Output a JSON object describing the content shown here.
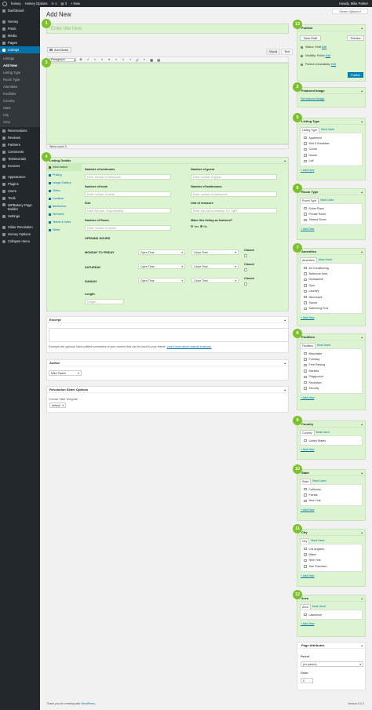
{
  "admin_bar": {
    "site_name": "homey",
    "updates": "1",
    "site_menu": "Homey Options",
    "comments": "3",
    "new_label": "New",
    "howdy": "Howdy, Mike Parker"
  },
  "sidebar": {
    "items_top": [
      "Dashboard",
      "Homey",
      "Posts",
      "Media",
      "Pages"
    ],
    "current": "Listings",
    "submenu": [
      "Listings",
      "Add New",
      "Listing Type",
      "Room Type",
      "Amenities",
      "Facilities",
      "Country",
      "State",
      "City",
      "Area"
    ],
    "items_bottom": [
      "Reservations",
      "Reviews",
      "Partners",
      "Comments",
      "Testimonials",
      "Invoices"
    ],
    "items_bottom2": [
      "Appearance",
      "Plugins",
      "Users",
      "Tools",
      "WPBakery Page Builder",
      "Settings"
    ],
    "items_bottom3": [
      "Slider Revolution",
      "Homey Options",
      "Collapse menu"
    ]
  },
  "screen_options": "Screen Options",
  "page_title": "Add New",
  "title_placeholder": "Enter title here",
  "editor": {
    "add_media": "Add Media",
    "tab_visual": "Visual",
    "tab_text": "Text",
    "format": "Paragraph",
    "word_count": "Word count: 0",
    "toolbar": [
      "B",
      "I",
      "≡",
      "≡",
      "❝",
      "≡",
      "≡",
      "≡",
      "🔗",
      "≡",
      "▦",
      "▤"
    ]
  },
  "badges": [
    "1",
    "2",
    "3",
    "4",
    "5",
    "6",
    "7",
    "8",
    "9",
    "10",
    "11",
    "12",
    "13"
  ],
  "listing_details": {
    "title": "Listing Details",
    "tabs": [
      "Information",
      "Pricing",
      "Image Gallery",
      "Video",
      "Location",
      "Bedrooms",
      "Services",
      "Terms & rules",
      "Slider"
    ],
    "fields": {
      "bedrooms_label": "Number of bedrooms",
      "bedrooms_ph": "Enter number of bedrooms",
      "guest_label": "Number of guest",
      "guest_ph": "Enter number of guest",
      "beds_label": "Number of beds",
      "beds_ph": "Enter number of beds",
      "bathrooms_label": "Number of bathrooms",
      "bathrooms_ph": "Enter number of bathrooms",
      "size_label": "Size",
      "size_ph": "Enter the size. Only numbers",
      "unit_label": "Unit of measure",
      "unit_ph": "Enter the unit of measure. Ex. SqFt",
      "room_label": "Number of Room",
      "room_ph": "Enter number of rooms",
      "featured_label": "Make this listing as featured?",
      "yes": "Yes",
      "no": "No",
      "opening_hours": "OPENING HOURS",
      "days": [
        "MONDAY TO FRIDAY",
        "SATURDAY",
        "SUNDAY"
      ],
      "open_time": "Open Time",
      "close_time": "Close Time",
      "closed": "Closed",
      "length_label": "Length",
      "length_ph": "Length"
    }
  },
  "excerpt": {
    "title": "Excerpt",
    "help": "Excerpts are optional hand-crafted summaries of your content that can be used in your theme.",
    "link": "Learn more about manual excerpts."
  },
  "author": {
    "title": "Author",
    "value": "Mike Parker"
  },
  "revslider": {
    "title": "Revolution Slider Options",
    "label": "Choose Slide Template",
    "value": "default"
  },
  "publish": {
    "title": "Publish",
    "save_draft": "Save Draft",
    "preview": "Preview",
    "status": "Status: Draft",
    "visibility": "Visibility: Public",
    "publish_when": "Publish immediately",
    "edit": "Edit",
    "button": "Publish"
  },
  "featured_image": {
    "title": "Featured Image",
    "link": "Set featured image"
  },
  "tax_common": {
    "most_used": "Most Used",
    "add_new": "+ Add New"
  },
  "taxonomies": [
    {
      "title": "Listing Type",
      "tab": "Listing Type",
      "items": [
        "Apartment",
        "Bed & Breakfast",
        "Condo",
        "House",
        "Loft"
      ]
    },
    {
      "title": "Room Type",
      "tab": "Room Type",
      "items": [
        "Entire Place",
        "Private Room",
        "Shared Room"
      ]
    },
    {
      "title": "Amenities",
      "tab": "Amenities",
      "items": [
        "Air Conditioning",
        "Barbecue Area",
        "Dishwasher",
        "Gym",
        "Laundry",
        "Microwave",
        "Sauna",
        "Swimming Pool"
      ]
    },
    {
      "title": "Facilities",
      "tab": "Facilities",
      "items": [
        "Beachside",
        "Formacy",
        "Free Parking",
        "Markets",
        "Playground",
        "Reception",
        "Security"
      ]
    },
    {
      "title": "Country",
      "tab": "Country",
      "items": [
        "United States"
      ]
    },
    {
      "title": "State",
      "tab": "State",
      "items": [
        "California",
        "Florida",
        "New York"
      ]
    },
    {
      "title": "City",
      "tab": "City",
      "items": [
        "Los Angeles",
        "Miami",
        "New York",
        "San Francisco"
      ]
    },
    {
      "title": "Area",
      "tab": "Area",
      "items": [
        "Lakeshore"
      ]
    }
  ],
  "page_attributes": {
    "title": "Page Attributes",
    "parent_label": "Parent",
    "parent_value": "(no parent)",
    "order_label": "Order",
    "order_value": "0"
  },
  "footer": {
    "thanks": "Thank you for creating with",
    "wp": "WordPress.",
    "version": "Version 5.0.3"
  }
}
